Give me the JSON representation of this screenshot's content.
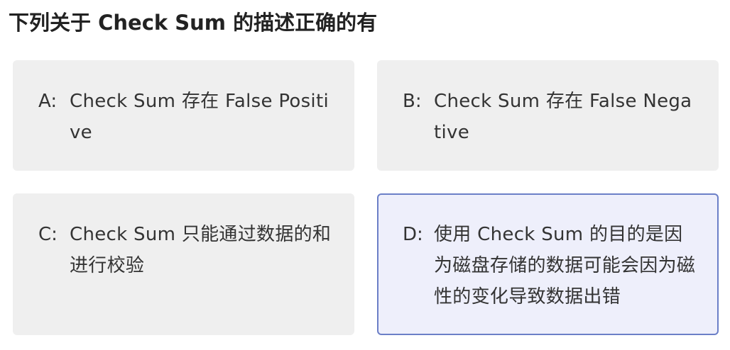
{
  "question": {
    "title": "下列关于 Check Sum 的描述正确的有"
  },
  "options": [
    {
      "key": "A:",
      "text": "Check Sum 存在 False Positive",
      "selected": false
    },
    {
      "key": "B:",
      "text": "Check Sum 存在 False Negative",
      "selected": false
    },
    {
      "key": "C:",
      "text": "Check Sum 只能通过数据的和进行校验",
      "selected": false
    },
    {
      "key": "D:",
      "text": "使用 Check Sum 的目的是因为磁盘存储的数据可能会因为磁性的变化导致数据出错",
      "selected": true
    }
  ],
  "colors": {
    "card_background": "#efefef",
    "selected_background": "#eeeffb",
    "selected_border": "#6b7fc7"
  }
}
